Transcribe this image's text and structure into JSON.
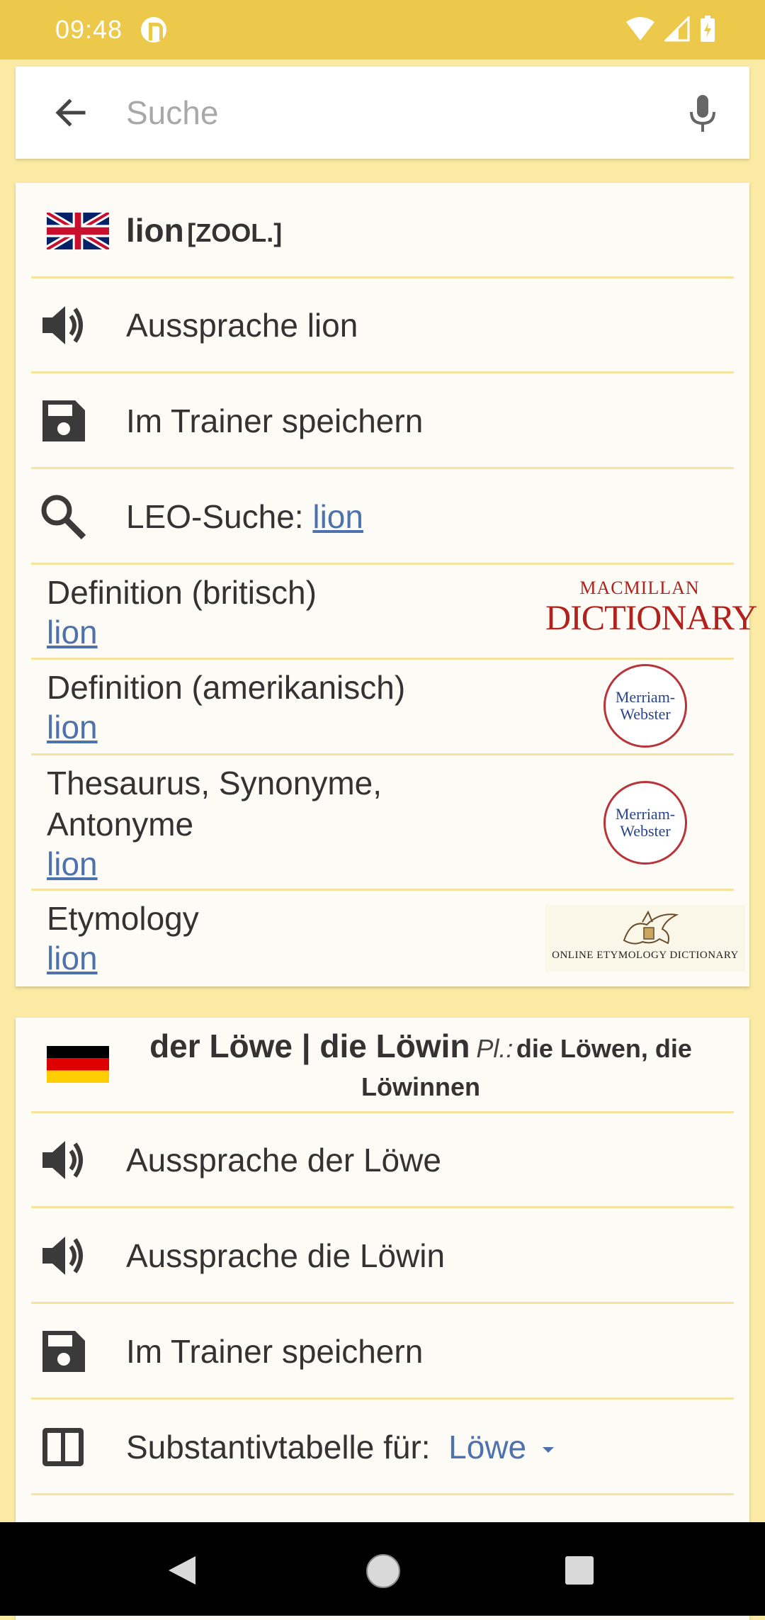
{
  "status_bar": {
    "time": "09:48"
  },
  "search": {
    "placeholder": "Suche"
  },
  "english_entry": {
    "word": "lion",
    "tag": "[ZOOL.]",
    "pronunciation_label": "Aussprache lion",
    "trainer_label": "Im Trainer speichern",
    "leo_search_label": "LEO-Suche:",
    "leo_search_link": "lion",
    "definitions": [
      {
        "title": "Definition (britisch)",
        "link": "lion",
        "logo": "macmillan-dictionary"
      },
      {
        "title": "Definition (amerikanisch)",
        "link": "lion",
        "logo": "merriam-webster"
      },
      {
        "title": "Thesaurus, Synonyme, Antonyme",
        "link": "lion",
        "logo": "merriam-webster"
      },
      {
        "title": "Etymology",
        "link": "lion",
        "logo": "online-etymology-dictionary"
      }
    ],
    "logo_texts": {
      "macmillan_top": "MACMILLAN",
      "macmillan_bottom": "DICTIONARY",
      "merriam_line1": "Merriam-",
      "merriam_line2": "Webster",
      "etymology": "ONLINE ETYMOLOGY DICTIONARY"
    }
  },
  "german_entry": {
    "word": "der Löwe | die Löwin",
    "plural_label": "Pl.:",
    "plural": "die Löwen, die",
    "plural_line2": "Löwinnen",
    "pronunciation_1": "Aussprache der Löwe",
    "pronunciation_2": "Aussprache die Löwin",
    "trainer_label": "Im Trainer speichern",
    "noun_table_label": "Substantivtabelle für:",
    "noun_table_value": "Löwe"
  },
  "icons": {
    "back": "arrow-left-icon",
    "mic": "microphone-icon",
    "speaker": "speaker-icon",
    "save": "floppy-disk-icon",
    "search": "magnifier-icon",
    "table": "table-icon"
  },
  "colors": {
    "status_bar": "#ecc94b",
    "background": "#fbeaa4",
    "link": "#4d72ae",
    "divider": "#f4e4a0"
  }
}
